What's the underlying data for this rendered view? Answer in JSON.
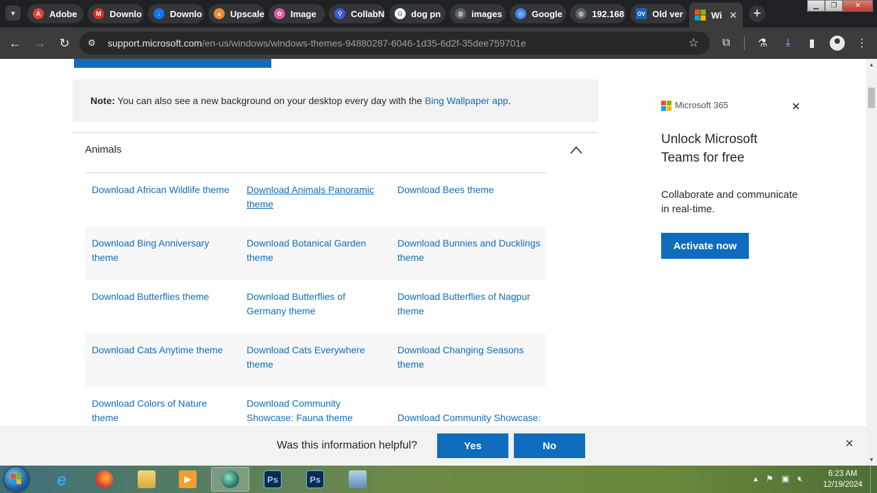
{
  "browser": {
    "tabs": [
      {
        "label": "Adobe",
        "icon": "adobe-icon",
        "color": "#e34234"
      },
      {
        "label": "Downlo",
        "icon": "gmail-icon",
        "color": "#d93025"
      },
      {
        "label": "Downlo",
        "icon": "download-icon",
        "color": "#1a73e8"
      },
      {
        "label": "Upscale",
        "icon": "upscale-icon",
        "color": "#f28b30"
      },
      {
        "label": "Image",
        "icon": "image-icon",
        "color": "#e05ca0"
      },
      {
        "label": "CollabN",
        "icon": "magnifier-icon",
        "color": "#3b5bdb"
      },
      {
        "label": "dog pn",
        "icon": "google-icon",
        "color": "#ffffff"
      },
      {
        "label": "images",
        "icon": "globe-icon",
        "color": "#5f6368"
      },
      {
        "label": "Google",
        "icon": "lens-icon",
        "color": "#4285f4"
      },
      {
        "label": "192.168",
        "icon": "globe-icon",
        "color": "#5f6368"
      },
      {
        "label": "Old ver",
        "icon": "ov-icon",
        "color": "#1565c0"
      },
      {
        "label": "Wi",
        "icon": "microsoft-icon",
        "color": "#f25022"
      }
    ],
    "url_host": "support.microsoft.com",
    "url_path": "/en-us/windows/windows-themes-94880287-6046-1d35-6d2f-35dee759701e"
  },
  "note": {
    "label": "Note:",
    "text": " You can also see a new background on your desktop every day with the ",
    "link": "Bing Wallpaper app",
    "end": "."
  },
  "section": {
    "title": "Animals",
    "rows": [
      [
        "Download African Wildlife theme",
        "Download Animals Panoramic theme",
        "Download Bees theme"
      ],
      [
        "Download Bing Anniversary theme",
        "Download Botanical Garden theme",
        "Download Bunnies and Ducklings theme"
      ],
      [
        "Download Butterflies theme",
        "Download Butterflies of Germany theme",
        "Download Butterflies of Nagpur theme"
      ],
      [
        "Download Cats Anytime theme",
        "Download Cats Everywhere theme",
        "Download Changing Seasons theme"
      ],
      [
        "Download Colors of Nature theme",
        "Download Community Showcase: Fauna theme",
        "Download Community Showcase:"
      ]
    ]
  },
  "ad": {
    "brand": "Microsoft 365",
    "title": "Unlock Microsoft Teams for free",
    "description": "Collaborate and communicate in real-time.",
    "cta": "Activate now"
  },
  "feedback": {
    "question": "Was this information helpful?",
    "yes": "Yes",
    "no": "No"
  },
  "taskbar": {
    "time": "6:23 AM",
    "date": "12/19/2024"
  },
  "colors": {
    "link": "#0f6cbd",
    "accent": "#0f6cbd",
    "chrome_dark": "#202124"
  }
}
